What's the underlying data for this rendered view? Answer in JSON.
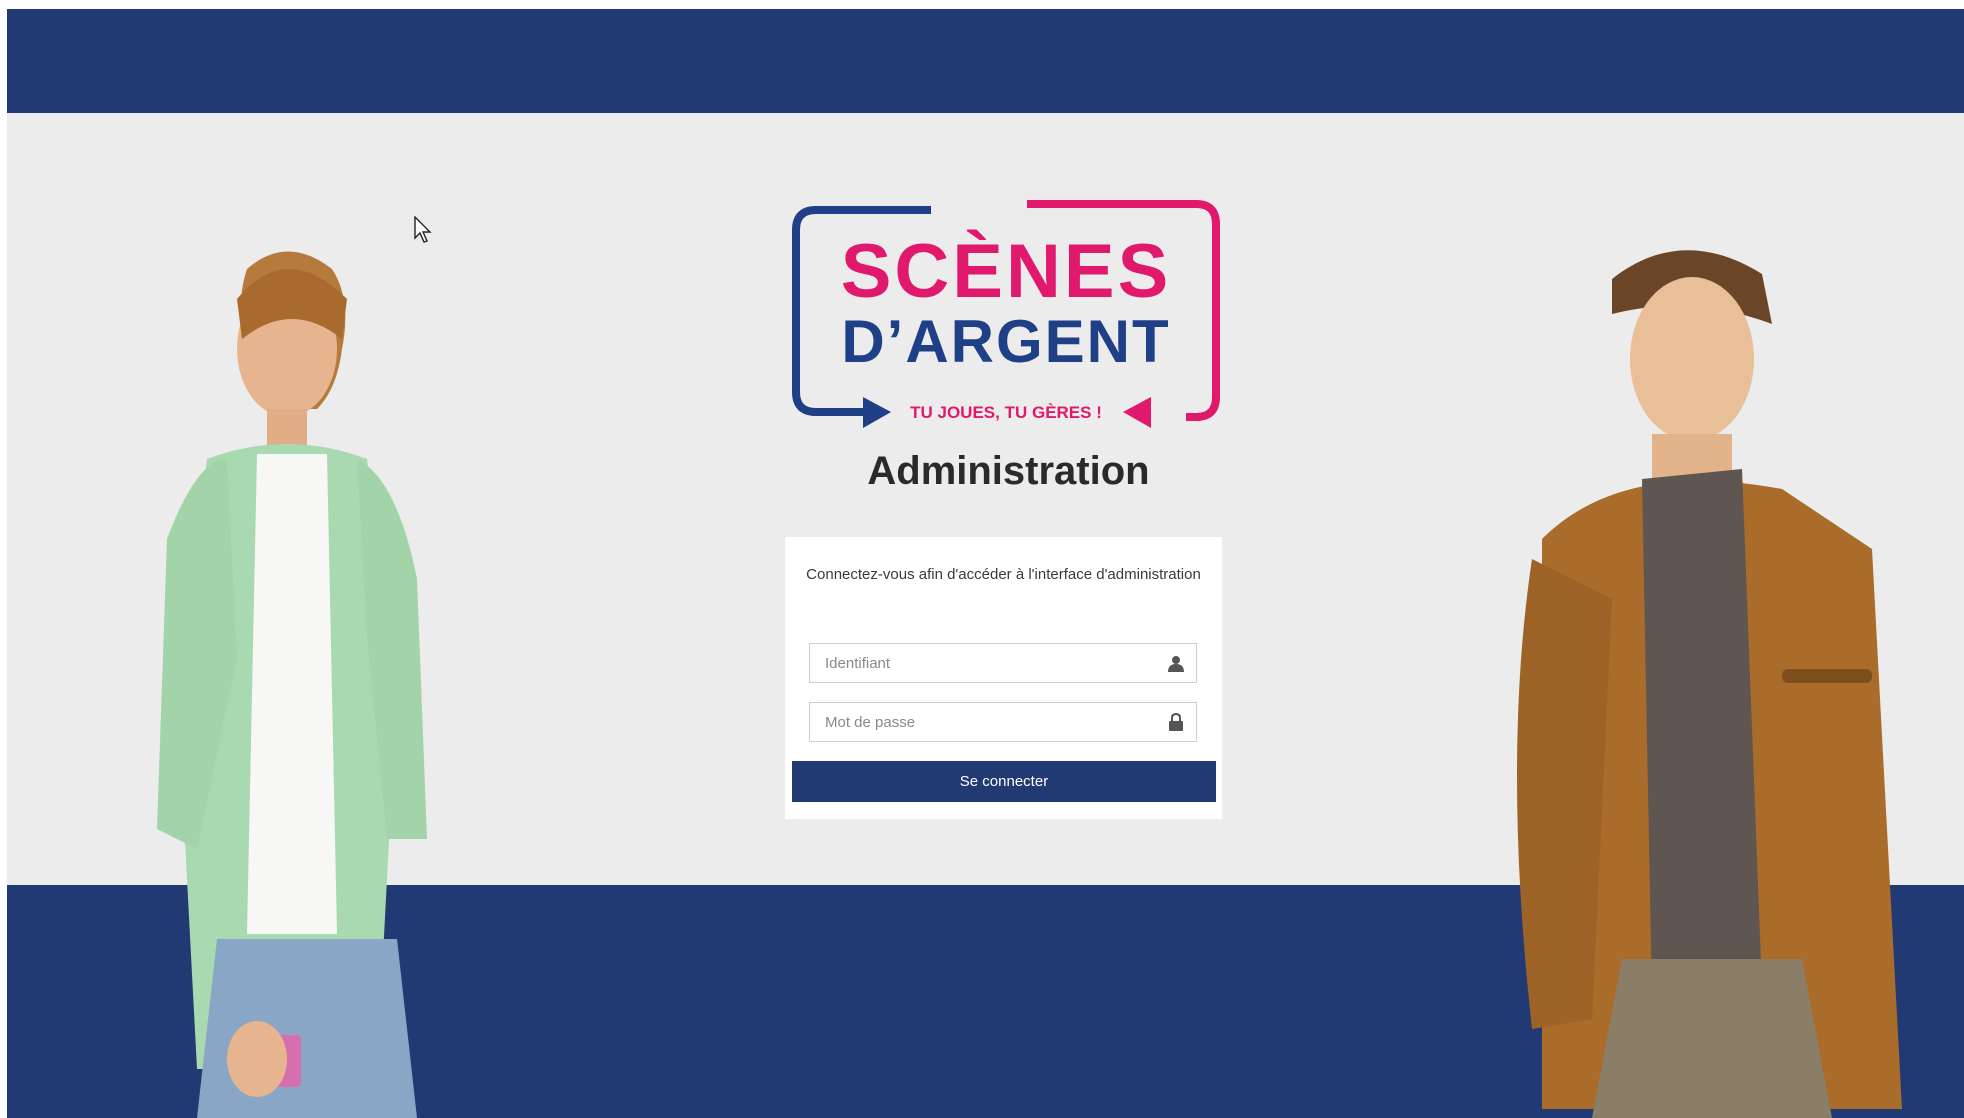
{
  "logo": {
    "line1": "SCÈNES",
    "line2": "D’ARGENT",
    "tagline": "TU JOUES, TU GÈRES !"
  },
  "page_title": "Administration",
  "login": {
    "intro": "Connectez-vous afin d'accéder à l'interface d'administration",
    "username_placeholder": "Identifiant",
    "password_placeholder": "Mot de passe",
    "submit_label": "Se connecter"
  },
  "colors": {
    "navy": "#223a74",
    "logo_blue": "#1f3f86",
    "logo_pink": "#e0196d",
    "page_bg": "#ececec"
  },
  "icons": {
    "username": "user-icon",
    "password": "lock-icon"
  }
}
